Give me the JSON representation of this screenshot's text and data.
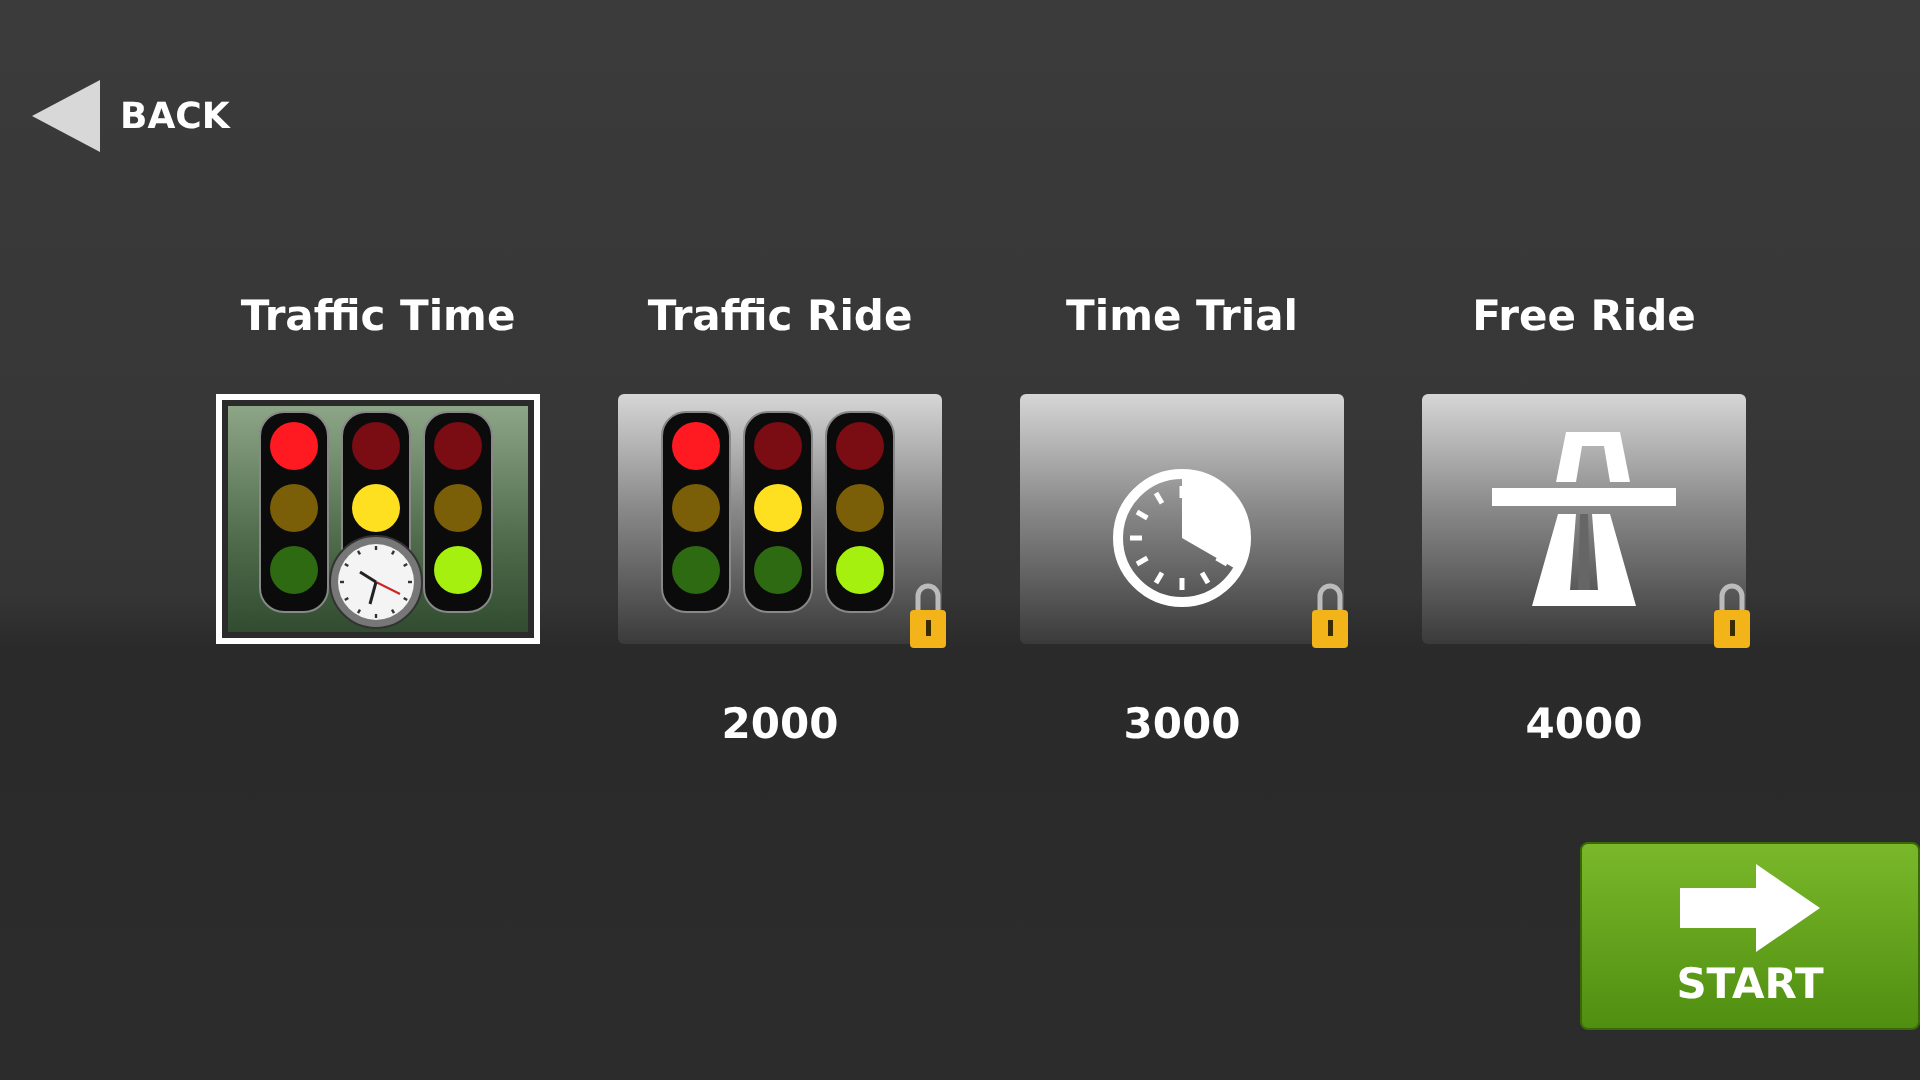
{
  "back_button": {
    "label": "BACK"
  },
  "modes": [
    {
      "kind": "traffic-time",
      "title": "Traffic Time",
      "selected": true,
      "locked": false
    },
    {
      "kind": "traffic-ride",
      "title": "Traffic Ride",
      "selected": false,
      "locked": true,
      "price": "2000"
    },
    {
      "kind": "time-trial",
      "title": "Time Trial",
      "selected": false,
      "locked": true,
      "price": "3000"
    },
    {
      "kind": "free-ride",
      "title": "Free Ride",
      "selected": false,
      "locked": true,
      "price": "4000"
    }
  ],
  "start_button": {
    "label": "START"
  }
}
